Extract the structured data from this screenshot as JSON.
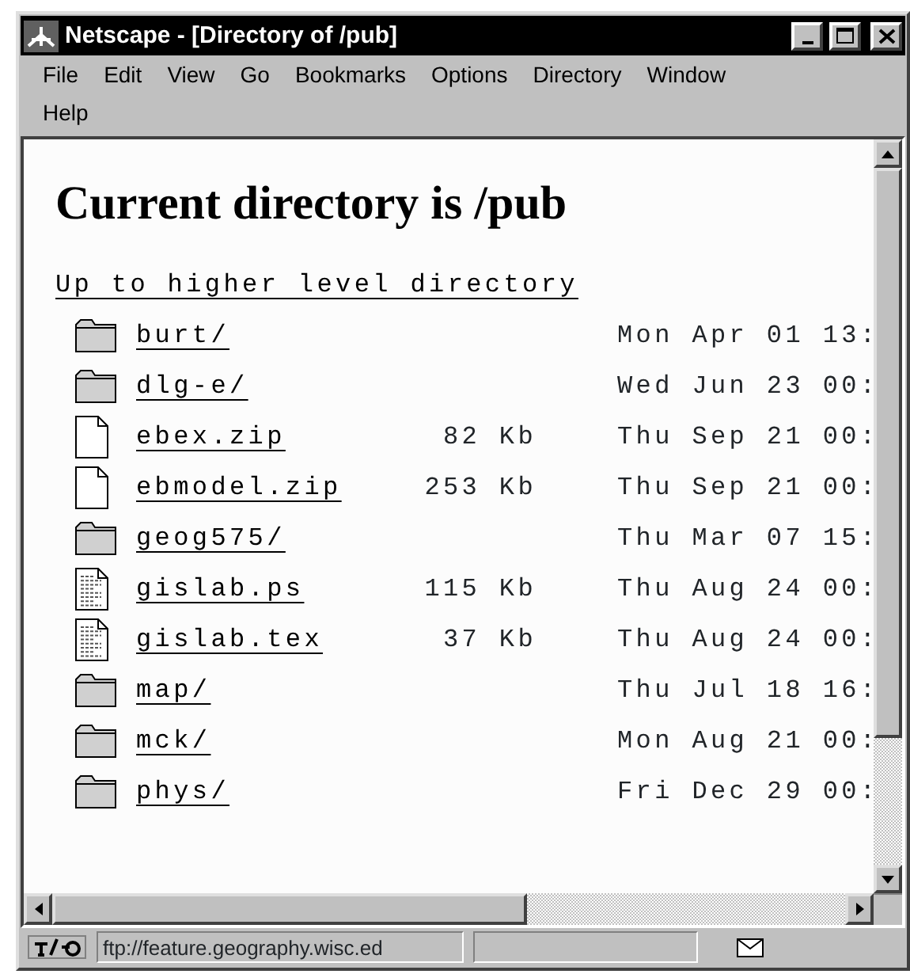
{
  "window": {
    "title": "Netscape - [Directory of /pub]"
  },
  "menu": [
    "File",
    "Edit",
    "View",
    "Go",
    "Bookmarks",
    "Options",
    "Directory",
    "Window",
    "Help"
  ],
  "page": {
    "heading": "Current directory is /pub",
    "up_link": "Up to higher level directory",
    "entries": [
      {
        "kind": "folder",
        "name": "burt/",
        "date": "Mon Apr 01 13:"
      },
      {
        "kind": "folder",
        "name": "dlg-e/",
        "date": "Wed Jun 23 00:"
      },
      {
        "kind": "file",
        "name": "ebex.zip",
        "size": "82 Kb",
        "date": "Thu Sep 21 00:"
      },
      {
        "kind": "file",
        "name": "ebmodel.zip",
        "size": "253 Kb",
        "date": "Thu Sep 21 00:"
      },
      {
        "kind": "folder",
        "name": "geog575/",
        "date": "Thu Mar 07 15:"
      },
      {
        "kind": "text",
        "name": "gislab.ps",
        "size": "115 Kb",
        "date": "Thu Aug 24 00:"
      },
      {
        "kind": "text",
        "name": "gislab.tex",
        "size": "37 Kb",
        "date": "Thu Aug 24 00:"
      },
      {
        "kind": "folder",
        "name": "map/",
        "date": "Thu Jul 18 16:"
      },
      {
        "kind": "folder",
        "name": "mck/",
        "date": "Mon Aug 21 00:"
      },
      {
        "kind": "folder",
        "name": "phys/",
        "date": "Fri Dec 29 00:"
      }
    ]
  },
  "status_bar": {
    "url": "ftp://feature.geography.wisc.ed"
  }
}
